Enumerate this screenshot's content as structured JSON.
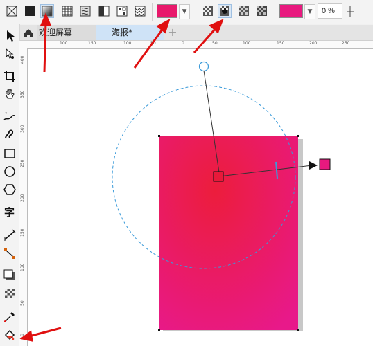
{
  "toolbar": {
    "fill_types": [
      "no-fill-icon",
      "uniform-fill-icon",
      "fountain-fill-icon",
      "pattern-fill-icon",
      "texture-fill-icon",
      "two-color-pattern-icon",
      "postscript-fill-icon",
      "bitmap-pattern-icon"
    ],
    "selected_fill": "fountain-fill-icon",
    "fill_color": "#e8196b",
    "node_color": "#e8197f",
    "transparency": "0 %"
  },
  "tabs": [
    {
      "label": "欢迎屏幕",
      "active": false
    },
    {
      "label": "海报*",
      "active": true
    }
  ],
  "rulers": {
    "horizontal": [
      "100",
      "150",
      "100",
      "50",
      "0",
      "50",
      "100",
      "150",
      "200",
      "250"
    ],
    "vertical": [
      "400",
      "350",
      "300",
      "250",
      "200",
      "150",
      "100",
      "50",
      "0"
    ]
  },
  "canvas": {
    "rect_gradient_start": "#ec1d3c",
    "rect_gradient_end": "#e8198a",
    "handle_start_color": "#e8193a",
    "handle_end_color": "#e8197f",
    "annotation_color": "#e01010"
  }
}
